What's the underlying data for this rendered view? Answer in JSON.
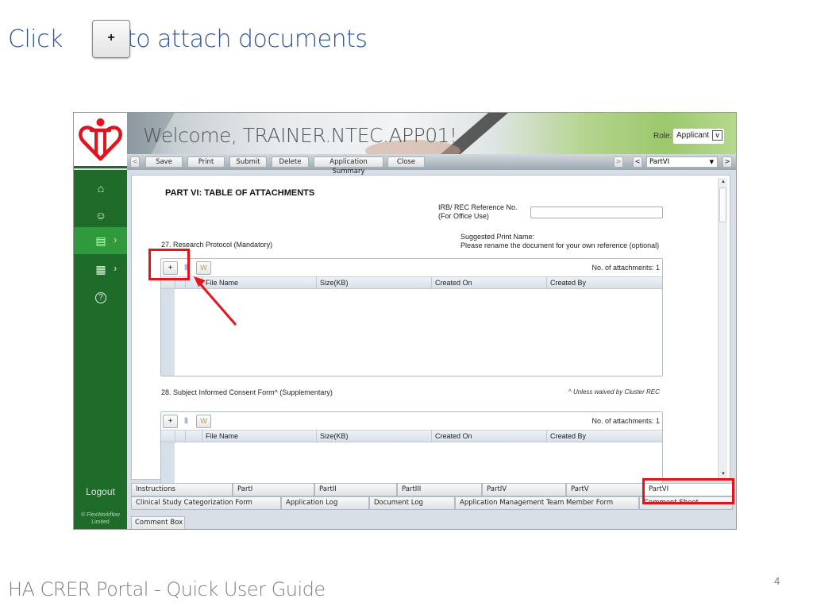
{
  "slide": {
    "title_part1": "Click",
    "title_part2": "to attach documents",
    "inline_button_label": "+",
    "footer": "HA CRER Portal - Quick User Guide",
    "page_number": "4"
  },
  "app": {
    "welcome": "Welcome, TRAINER.NTEC.APP01!",
    "role_label": "Role:",
    "role_value": "Applicant",
    "toolbar": {
      "prev": "<",
      "buttons": [
        "Save",
        "Print",
        "Submit",
        "Delete",
        "Application Summary",
        "Close"
      ],
      "next_disabled": ">",
      "part_prev": "<",
      "part_select": "PartVI",
      "part_next": ">"
    },
    "sidebar": {
      "items": [
        {
          "icon": "home-icon",
          "glyph": "⌂"
        },
        {
          "icon": "user-icon",
          "glyph": "☺"
        },
        {
          "icon": "clipboard-icon",
          "glyph": "▤",
          "active": true,
          "arrow": "›"
        },
        {
          "icon": "grid-icon",
          "glyph": "▦",
          "arrow": "›"
        },
        {
          "icon": "help-icon",
          "glyph": "?"
        }
      ],
      "logout": "Logout",
      "copyright_line1": "© FlexWorkflow",
      "copyright_line2": "Limited"
    },
    "form": {
      "heading": "PART VI: TABLE OF ATTACHMENTS",
      "irb_label_line1": "IRB/ REC Reference No.",
      "irb_label_line2": "(For Office Use)",
      "irb_value": "",
      "suggested_line1": "Suggested Print Name:",
      "suggested_line2": "Please rename the document for your own reference (optional)",
      "sections": [
        {
          "label": "27. Research Protocol (Mandatory)",
          "attachments_label": "No. of attachments: 1",
          "columns": [
            "File Name",
            "Size(KB)",
            "Created On",
            "Created By"
          ]
        },
        {
          "label": "28. Subject Informed Consent Form^ (Supplementary)",
          "note": "^ Unless waived by Cluster REC",
          "attachments_label": "No. of attachments: 1",
          "columns": [
            "File Name",
            "Size(KB)",
            "Created On",
            "Created By"
          ]
        }
      ],
      "grid_add": "+",
      "grid_save": "▮",
      "grid_word": "W"
    },
    "tabs_row1": [
      "Instructions",
      "PartI",
      "PartII",
      "PartIII",
      "PartIV",
      "PartV",
      "PartVI"
    ],
    "tabs_row2": [
      "Clinical Study Categorization Form",
      "Application Log",
      "Document Log",
      "Application Management Team Member Form",
      "Comment Sheet"
    ],
    "comment_box": "Comment Box"
  },
  "colors": {
    "title_blue": "#2f5597",
    "sidebar_green": "#1e6b2a",
    "sidebar_active": "#2f9a3c",
    "highlight_red": "#e8121b",
    "logo_red": "#e0141e"
  }
}
